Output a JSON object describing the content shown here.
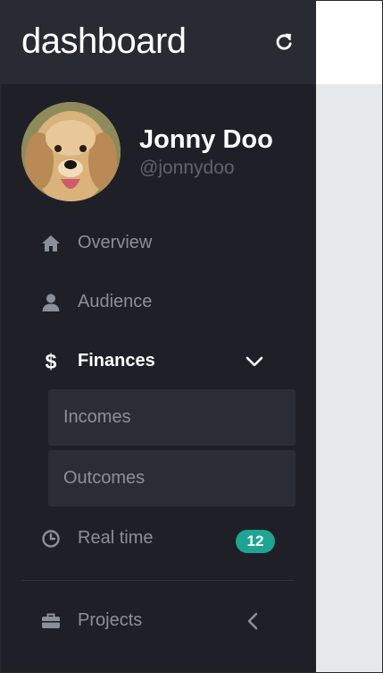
{
  "app": {
    "title": "dashboard"
  },
  "user": {
    "name": "Jonny Doo",
    "handle": "@jonnydoo"
  },
  "nav": {
    "overview": {
      "label": "Overview",
      "icon": "home-icon"
    },
    "audience": {
      "label": "Audience",
      "icon": "user-icon"
    },
    "finances": {
      "label": "Finances",
      "icon_glyph": "$",
      "expanded": true,
      "sub": [
        {
          "label": "Incomes"
        },
        {
          "label": "Outcomes"
        }
      ]
    },
    "realtime": {
      "label": "Real time",
      "icon": "clock-icon",
      "badge": "12"
    },
    "projects": {
      "label": "Projects",
      "icon": "briefcase-icon"
    }
  },
  "colors": {
    "sidebar": "#1f2027",
    "brand_bar": "#292b33",
    "badge": "#1fa392",
    "submenu": "#2b2d36",
    "muted_text": "#8b8f9a"
  }
}
